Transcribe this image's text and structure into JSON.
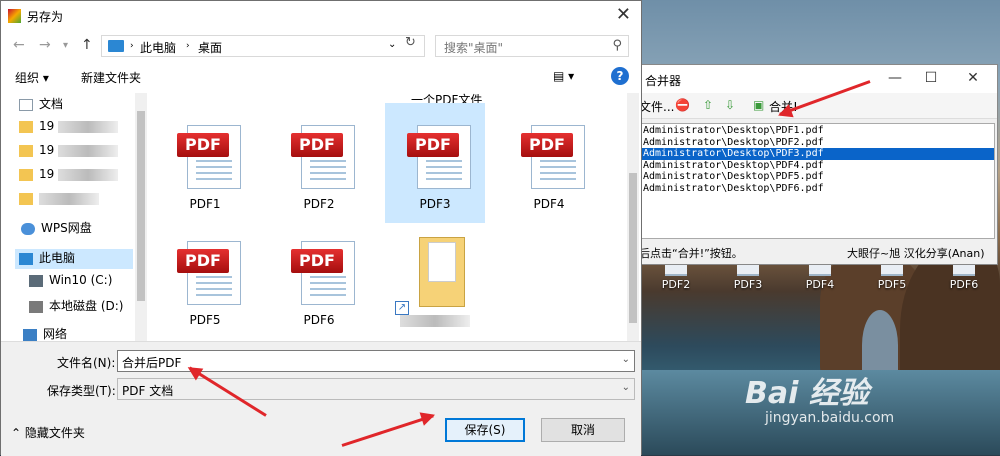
{
  "desktop": {
    "icons": [
      "PDF2",
      "PDF3",
      "PDF4",
      "PDF5",
      "PDF6"
    ],
    "watermark": "Bai 经验",
    "watermark_url": "jingyan.baidu.com"
  },
  "merger": {
    "title": "合并器",
    "toolbar": {
      "file_label": "文件...",
      "merge_label": "合并!"
    },
    "files": [
      "Administrator\\Desktop\\PDF1.pdf",
      "Administrator\\Desktop\\PDF2.pdf",
      "Administrator\\Desktop\\PDF3.pdf",
      "Administrator\\Desktop\\PDF4.pdf",
      "Administrator\\Desktop\\PDF5.pdf",
      "Administrator\\Desktop\\PDF6.pdf"
    ],
    "selected_index": 2,
    "status": "后点击“合并!”按钮。",
    "credit": "大眼仔~旭 汉化分享(Anan)"
  },
  "dialog": {
    "title": "另存为",
    "address": {
      "crumb1": "此电脑",
      "crumb2": "桌面"
    },
    "search_placeholder": "搜索\"桌面\"",
    "commands": {
      "organize": "组织 ▾",
      "new_folder": "新建文件夹"
    },
    "nav": {
      "documents": "文档",
      "folder_partials": [
        "19",
        "19",
        "19",
        ""
      ],
      "wps": "WPS网盘",
      "this_pc": "此电脑",
      "drive_c": "Win10 (C:)",
      "drive_d": "本地磁盘 (D:)",
      "network": "网络"
    },
    "tooltip_label": "一个PDF文件",
    "files": [
      "PDF1",
      "PDF2",
      "PDF3",
      "PDF4",
      "PDF5",
      "PDF6"
    ],
    "selected_file": "PDF3",
    "filename_label": "文件名(N):",
    "filename_value": "合并后PDF",
    "filetype_label": "保存类型(T):",
    "filetype_value": "PDF 文档",
    "hide_folders": "隐藏文件夹",
    "save_button": "保存(S)",
    "cancel_button": "取消"
  }
}
